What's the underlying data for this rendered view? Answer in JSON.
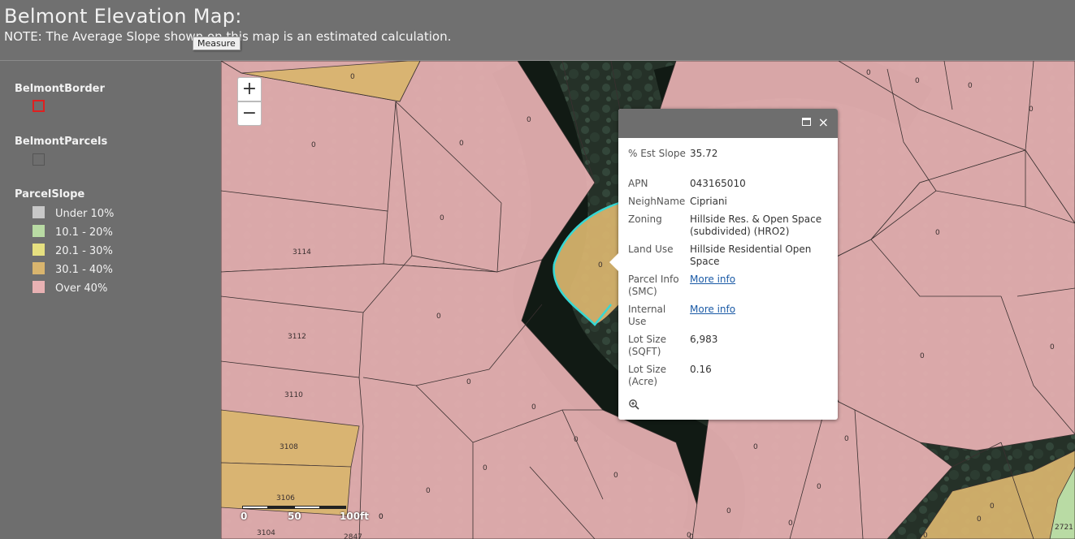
{
  "header": {
    "title": "Belmont Elevation Map:",
    "note": "NOTE: The Average Slope shown on this map is an estimated calculation.",
    "tooltip": "Measure"
  },
  "legend": {
    "border_title": "BelmontBorder",
    "border_color": "#e02020",
    "parcels_title": "BelmontParcels",
    "parcels_color": "#555555",
    "slope_title": "ParcelSlope",
    "classes": [
      {
        "label": "Under 10%",
        "color": "#c8c8c8"
      },
      {
        "label": "10.1 - 20%",
        "color": "#b9dba4"
      },
      {
        "label": "20.1 - 30%",
        "color": "#e6e080"
      },
      {
        "label": "30.1 - 40%",
        "color": "#d9b56e"
      },
      {
        "label": "Over 40%",
        "color": "#e8b1b3"
      }
    ]
  },
  "map": {
    "zoom_in": "+",
    "zoom_out": "−",
    "scale": {
      "labels": [
        "0",
        "50",
        "100ft"
      ]
    },
    "parcel_labels": [
      "0",
      "0",
      "0",
      "0",
      "0",
      "0",
      "0",
      "0",
      "0",
      "0",
      "0",
      "0",
      "0",
      "0",
      "0",
      "0",
      "0",
      "0",
      "0",
      "0",
      "0",
      "0",
      "0",
      "0",
      "0",
      "0",
      "0",
      "0",
      "0",
      "3114",
      "3112",
      "3110",
      "3108",
      "3106",
      "3104",
      "2847",
      "2721",
      "0",
      "0",
      "0"
    ]
  },
  "popup": {
    "rows": [
      {
        "key": "% Est Slope",
        "value": "35.72"
      },
      {
        "key": "APN",
        "value": "043165010"
      },
      {
        "key": "NeighName",
        "value": "Cipriani"
      },
      {
        "key": "Zoning",
        "value": "Hillside Res. & Open Space (subdivided) (HRO2)"
      },
      {
        "key": "Land Use",
        "value": "Hillside Residential Open Space"
      },
      {
        "key": "Parcel Info (SMC)",
        "value": "More info",
        "link": true
      },
      {
        "key": "Internal Use",
        "value": "More info",
        "link": true
      },
      {
        "key": "Lot Size (SQFT)",
        "value": "6,983"
      },
      {
        "key": "Lot Size (Acre)",
        "value": "0.16"
      }
    ],
    "close": "×"
  }
}
